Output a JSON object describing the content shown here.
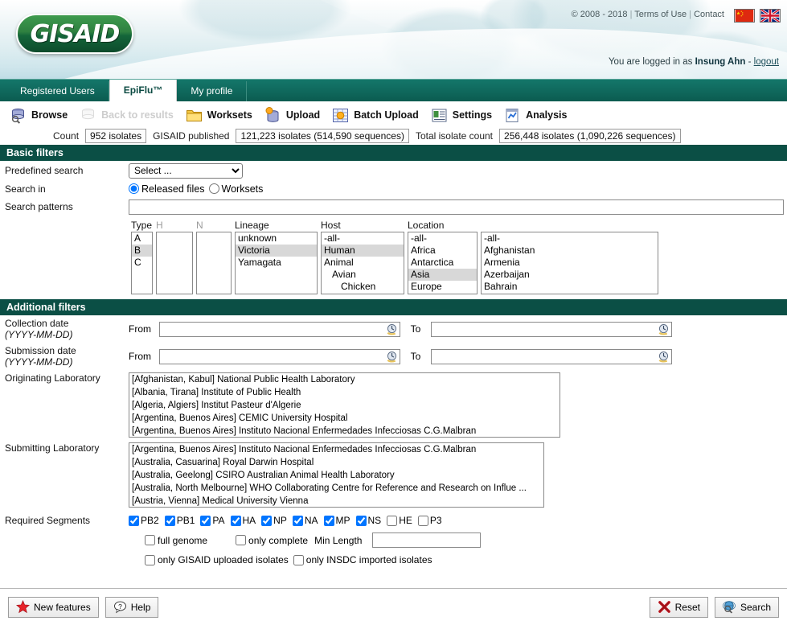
{
  "header": {
    "logo_text": "GISAID",
    "copyright": "© 2008 - 2018",
    "terms_label": "Terms of Use",
    "contact_label": "Contact",
    "separator": "|",
    "login_prefix": "You are logged in as",
    "user_name": "Insung Ahn",
    "login_dash": "-",
    "logout_label": "logout",
    "flags": [
      "flag-china",
      "flag-uk"
    ]
  },
  "tabs": [
    {
      "label": "Registered Users",
      "active": false
    },
    {
      "label": "EpiFlu™",
      "active": true
    },
    {
      "label": "My profile",
      "active": false
    }
  ],
  "toolbar": [
    {
      "label": "Browse",
      "icon": "browse-icon",
      "disabled": false
    },
    {
      "label": "Back to results",
      "icon": "back-to-results-icon",
      "disabled": true
    },
    {
      "label": "Worksets",
      "icon": "worksets-folder-icon",
      "disabled": false
    },
    {
      "label": "Upload",
      "icon": "upload-icon",
      "disabled": false
    },
    {
      "label": "Batch Upload",
      "icon": "batch-upload-icon",
      "disabled": false
    },
    {
      "label": "Settings",
      "icon": "settings-icon",
      "disabled": false
    },
    {
      "label": "Analysis",
      "icon": "analysis-icon",
      "disabled": false
    }
  ],
  "counts": {
    "count_label": "Count",
    "count_value": "952 isolates",
    "published_label": "GISAID published",
    "published_value": "121,223 isolates (514,590 sequences)",
    "total_label": "Total isolate count",
    "total_value": "256,448 isolates (1,090,226 sequences)"
  },
  "basic_filters": {
    "title": "Basic filters",
    "predefined_search_label": "Predefined search",
    "predefined_search_value": "Select ...",
    "search_in_label": "Search in",
    "search_in_options": [
      "Released files",
      "Worksets"
    ],
    "search_in_selected": "Released files",
    "search_patterns_label": "Search patterns",
    "search_patterns_value": "",
    "search_patterns_placeholder": ""
  },
  "lists": {
    "type": {
      "caption": "Type",
      "options": [
        "A",
        "B",
        "C"
      ],
      "selected": [
        "B"
      ]
    },
    "h": {
      "caption": "H",
      "options": [],
      "selected": []
    },
    "n": {
      "caption": "N",
      "options": [],
      "selected": []
    },
    "lineage": {
      "caption": "Lineage",
      "options": [
        "unknown",
        "Victoria",
        "Yamagata"
      ],
      "selected": [
        "Victoria"
      ]
    },
    "host": {
      "caption": "Host",
      "options": [
        "-all-",
        "Human",
        "Animal",
        "Avian",
        "Chicken"
      ],
      "indents": [
        0,
        0,
        0,
        1,
        2
      ],
      "selected": [
        "Human"
      ]
    },
    "location_region": {
      "caption": "Location",
      "options": [
        "-all-",
        "Africa",
        "Antarctica",
        "Asia",
        "Europe"
      ],
      "selected": [
        "Asia"
      ]
    },
    "location_country": {
      "caption": "",
      "options": [
        "-all-",
        "Afghanistan",
        "Armenia",
        "Azerbaijan",
        "Bahrain"
      ],
      "selected": []
    }
  },
  "additional_filters": {
    "title": "Additional filters",
    "collection_date_label": "Collection date",
    "collection_date_format": "(YYYY-MM-DD)",
    "submission_date_label": "Submission date",
    "submission_date_format": "(YYYY-MM-DD)",
    "from_label": "From",
    "to_label": "To",
    "collection_from_value": "",
    "collection_to_value": "",
    "submission_from_value": "",
    "submission_to_value": "",
    "calendar_icon": "calendar-icon",
    "originating_lab_label": "Originating Laboratory",
    "originating_lab_options": [
      "[Afghanistan, Kabul] National Public Health Laboratory",
      "[Albania, Tirana] Institute of Public Health",
      "[Algeria, Algiers] Institut Pasteur d'Algerie",
      "[Argentina, Buenos Aires] CEMIC University Hospital",
      "[Argentina, Buenos Aires] Instituto Nacional Enfermedades Infecciosas C.G.Malbran"
    ],
    "submitting_lab_label": "Submitting Laboratory",
    "submitting_lab_options": [
      "[Argentina, Buenos Aires] Instituto Nacional Enfermedades Infecciosas C.G.Malbran",
      "[Australia, Casuarina] Royal Darwin Hospital",
      "[Australia, Geelong] CSIRO Australian Animal Health Laboratory",
      "[Australia, North Melbourne] WHO Collaborating Centre for Reference and Research on Influe ...",
      "[Austria, Vienna] Medical University Vienna"
    ],
    "required_segments_label": "Required Segments",
    "segments": [
      {
        "label": "PB2",
        "checked": true
      },
      {
        "label": "PB1",
        "checked": true
      },
      {
        "label": "PA",
        "checked": true
      },
      {
        "label": "HA",
        "checked": true
      },
      {
        "label": "NP",
        "checked": true
      },
      {
        "label": "NA",
        "checked": true
      },
      {
        "label": "MP",
        "checked": true
      },
      {
        "label": "NS",
        "checked": true
      },
      {
        "label": "HE",
        "checked": false
      },
      {
        "label": "P3",
        "checked": false
      }
    ],
    "full_genome_label": "full genome",
    "full_genome_checked": false,
    "only_complete_label": "only complete",
    "only_complete_checked": false,
    "min_length_label": "Min Length",
    "min_length_value": "",
    "only_gisaid_label": "only GISAID uploaded isolates",
    "only_gisaid_checked": false,
    "only_insdc_label": "only INSDC imported isolates",
    "only_insdc_checked": false
  },
  "footer": {
    "new_features_label": "New features",
    "new_features_icon": "star-icon",
    "help_label": "Help",
    "help_icon": "question-bubble-icon",
    "reset_label": "Reset",
    "reset_icon": "red-x-icon",
    "search_label": "Search",
    "search_icon": "globe-search-icon"
  },
  "colors": {
    "header_green": "#0b4f45",
    "tab_green": "#0b5b50",
    "selection_gray": "#d8d8d8",
    "accent_blue": "#2a7ae2"
  }
}
